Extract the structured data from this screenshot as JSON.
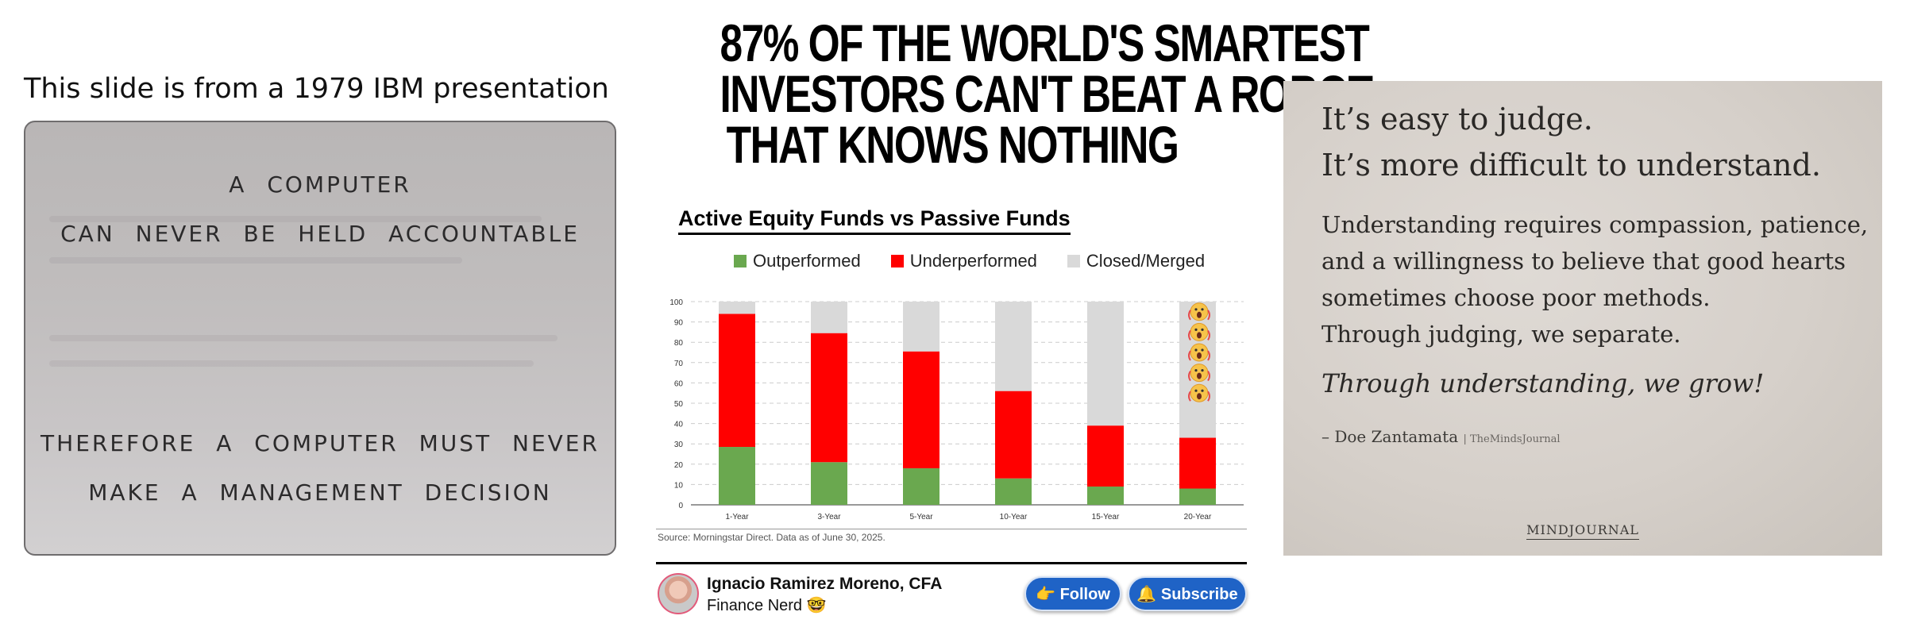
{
  "left_panel": {
    "caption": "This slide is from a 1979 IBM presentation",
    "slide_lines": [
      "A COMPUTER",
      "CAN NEVER BE HELD ACCOUNTABLE",
      "THEREFORE A COMPUTER MUST NEVER",
      "MAKE A MANAGEMENT DECISION"
    ]
  },
  "middle_panel": {
    "headline_lines": [
      "87% OF THE WORLD'S SMARTEST",
      "INVESTORS CAN'T BEAT A ROBOT",
      "THAT KNOWS NOTHING"
    ],
    "source_note": "Source: Morningstar Direct. Data as of June 30, 2025.",
    "author": {
      "name": "Ignacio Ramirez Moreno, CFA",
      "bio": "Finance Nerd 🤓"
    },
    "buttons": {
      "follow": "👉 Follow",
      "subscribe": "🔔 Subscribe"
    },
    "colors": {
      "outperformed": "#6aa84f",
      "underperformed": "#ff0000",
      "closed": "#d9d9d9",
      "button": "#1f63c6"
    }
  },
  "chart_data": {
    "type": "bar",
    "title": "Active Equity Funds vs Passive Funds",
    "stacked": true,
    "categories": [
      "1-Year",
      "3-Year",
      "5-Year",
      "10-Year",
      "15-Year",
      "20-Year"
    ],
    "series": [
      {
        "name": "Outperformed",
        "values": [
          28.5,
          21,
          18,
          13,
          9,
          8
        ]
      },
      {
        "name": "Underperformed",
        "values": [
          65.5,
          63.5,
          57.5,
          43,
          30,
          25
        ]
      },
      {
        "name": "Closed/Merged",
        "values": [
          6,
          15.5,
          24.5,
          44,
          61,
          67
        ]
      }
    ],
    "ylim": [
      0,
      100
    ],
    "yticks": [
      0,
      10,
      20,
      30,
      40,
      50,
      60,
      70,
      80,
      90,
      100
    ],
    "grid": true,
    "legend_position": "top",
    "annotation_icon": "screaming-face-emoji",
    "annotation_count": 5,
    "annotation_category": "20-Year"
  },
  "right_panel": {
    "heading_lines": [
      "It’s easy to judge.",
      "It’s more difficult to understand."
    ],
    "body_lines": [
      "Understanding requires compassion, patience,",
      "and a willingness to believe that good hearts",
      "sometimes choose poor methods.",
      "Through judging, we separate."
    ],
    "emphasis": "Through understanding, we grow!",
    "attribution": "– Doe Zantamata",
    "attribution_source": "| TheMindsJournal",
    "brand": "MINDJOURNAL"
  }
}
